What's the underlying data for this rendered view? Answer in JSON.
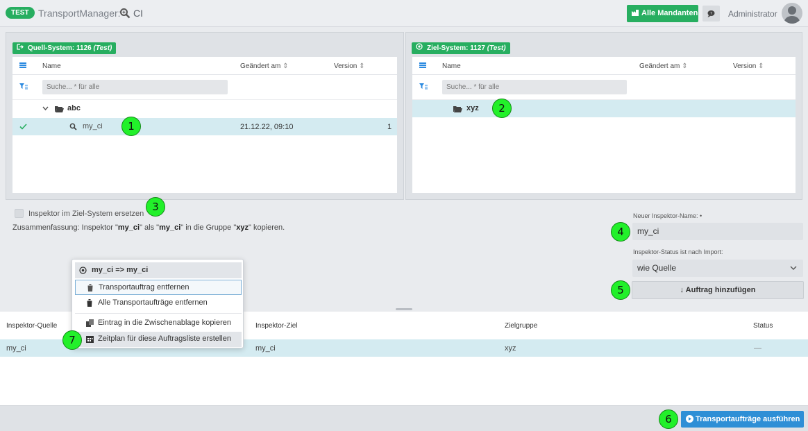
{
  "header": {
    "env_badge": "TEST",
    "app_title": "TransportManager:",
    "object_name": "CI",
    "all_clients_label": "Alle Mandanten",
    "user_name": "Administrator"
  },
  "source": {
    "badge": "Quell-System: 1126",
    "badge_env": "(Test)",
    "columns": {
      "name": "Name",
      "changed": "Geändert am",
      "version": "Version"
    },
    "search_placeholder": "Suche... * für alle",
    "folder": "abc",
    "item": {
      "name": "my_ci",
      "changed": "21.12.22, 09:10",
      "version": "1"
    }
  },
  "target": {
    "badge": "Ziel-System: 1127",
    "badge_env": "(Test)",
    "columns": {
      "name": "Name",
      "changed": "Geändert am",
      "version": "Version"
    },
    "search_placeholder": "Suche... * für alle",
    "folder": "xyz"
  },
  "options": {
    "replace_label": "Inspektor im Ziel-System ersetzen",
    "summary_prefix": "Zusammenfassung: Inspektor \"",
    "summary_src": "my_ci",
    "summary_mid": "\" als \"",
    "summary_dst": "my_ci",
    "summary_mid2": "\" in die Gruppe \"",
    "summary_group": "xyz",
    "summary_suffix": "\" kopieren.",
    "new_name_label": "Neuer Inspektor-Name: •",
    "new_name_value": "my_ci",
    "status_label": "Inspektor-Status ist nach Import:",
    "status_value": "wie Quelle",
    "add_button": "Auftrag hinzufügen"
  },
  "queue": {
    "columns": {
      "source": "Inspektor-Quelle",
      "target": "Inspektor-Ziel",
      "group": "Zielgruppe",
      "status": "Status"
    },
    "rows": [
      {
        "source": "my_ci",
        "target": "my_ci",
        "group": "xyz",
        "status": "—"
      }
    ],
    "run_button": "Transportaufträge ausführen"
  },
  "context_menu": {
    "title": "my_ci => my_ci",
    "items": [
      "Transportauftrag entfernen",
      "Alle Transportaufträge entfernen",
      "Eintrag in die Zwischenablage kopieren",
      "Zeitplan für diese Auftragsliste erstellen"
    ]
  },
  "markers": [
    "1",
    "2",
    "3",
    "4",
    "5",
    "6",
    "7"
  ],
  "colors": {
    "accent_green": "#27ae60",
    "accent_blue": "#2e8fd6",
    "selection": "#d4ebf1",
    "marker": "#22f02a"
  }
}
